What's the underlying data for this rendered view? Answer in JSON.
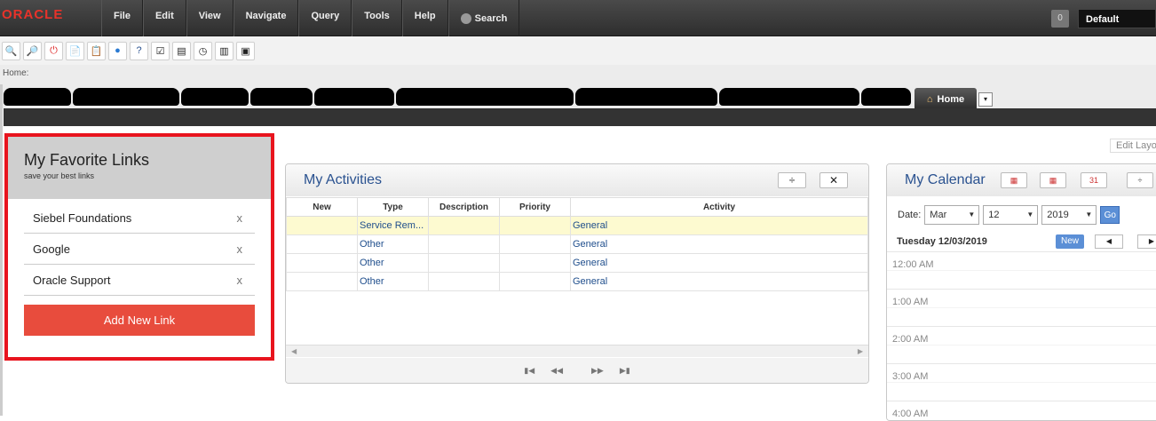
{
  "app": {
    "logo": "ORACLE"
  },
  "menu": {
    "items": [
      "File",
      "Edit",
      "View",
      "Navigate",
      "Query",
      "Tools",
      "Help"
    ],
    "search_label": "Search",
    "badge": "0",
    "profile": "Default"
  },
  "toolbar": {
    "icons": [
      "zoom-out-icon",
      "zoom-in-icon",
      "power-icon",
      "new-record-icon",
      "copy-icon",
      "globe-icon",
      "help-icon",
      "checklist-icon",
      "print-icon",
      "clock-icon",
      "chart-icon",
      "record-icon"
    ]
  },
  "breadcrumb": "Home:",
  "tabs": {
    "home_label": "Home"
  },
  "edit_layout": "Edit Layo",
  "favorites": {
    "title": "My Favorite Links",
    "subtitle": "save your best links",
    "links": [
      {
        "label": "Siebel Foundations",
        "remove": "x"
      },
      {
        "label": "Google",
        "remove": "x"
      },
      {
        "label": "Oracle Support",
        "remove": "x"
      }
    ],
    "add_label": "Add New Link"
  },
  "activities": {
    "title": "My Activities",
    "close": "✕",
    "columns": [
      "New",
      "Type",
      "Description",
      "Priority",
      "Activity"
    ],
    "rows": [
      {
        "new": "",
        "type": "Service Rem...",
        "description": "",
        "priority": "",
        "activity": "General"
      },
      {
        "new": "",
        "type": "Other",
        "description": "",
        "priority": "",
        "activity": "General"
      },
      {
        "new": "",
        "type": "Other",
        "description": "",
        "priority": "",
        "activity": "General"
      },
      {
        "new": "",
        "type": "Other",
        "description": "",
        "priority": "",
        "activity": "General"
      }
    ]
  },
  "calendar": {
    "title": "My Calendar",
    "date_label": "Date:",
    "month": "Mar",
    "day": "12",
    "year": "2019",
    "go": "Go",
    "current_day": "Tuesday 12/03/2019",
    "new_label": "New",
    "hours": [
      "12:00 AM",
      "1:00 AM",
      "2:00 AM",
      "3:00 AM",
      "4:00 AM"
    ]
  }
}
